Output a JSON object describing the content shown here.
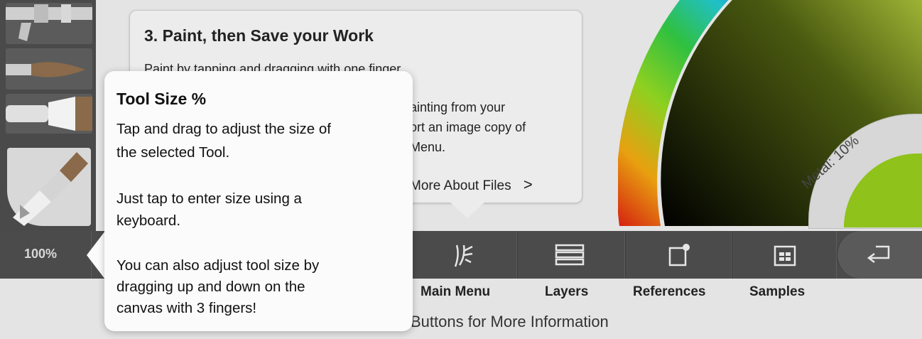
{
  "card": {
    "title": "3. Paint, then Save your Work",
    "line1": "Paint by tapping and dragging with one finger.",
    "line2": "ainting from your",
    "line3": "ort an image copy of",
    "line4": "Menu.",
    "more_link": "More About Files",
    "more_chevron": ">"
  },
  "metal": {
    "label": "Metal: 10%"
  },
  "tool_size": {
    "value": "100%"
  },
  "toolbar": {
    "main_menu": "Main Menu",
    "layers": "Layers",
    "references": "References",
    "samples": "Samples"
  },
  "hint": "Buttons for More Information",
  "tooltip": {
    "title": "Tool Size %",
    "line1": "Tap and drag to adjust the size of",
    "line2": "the selected Tool.",
    "line3": "Just tap to enter size using a",
    "line4": "keyboard.",
    "line5": "You can also adjust tool size by",
    "line6": "dragging up and down on the",
    "line7": "canvas with 3 fingers!"
  },
  "icons": [
    "airbrush-icon",
    "round-brush-icon",
    "flat-brush-icon",
    "active-brush-icon",
    "main-menu-icon",
    "layers-icon",
    "references-icon",
    "samples-icon",
    "back-icon"
  ],
  "colors": {
    "accent_green": "#8fc21a",
    "bar": "#4b4b4b",
    "panel": "#e4e4e4"
  }
}
